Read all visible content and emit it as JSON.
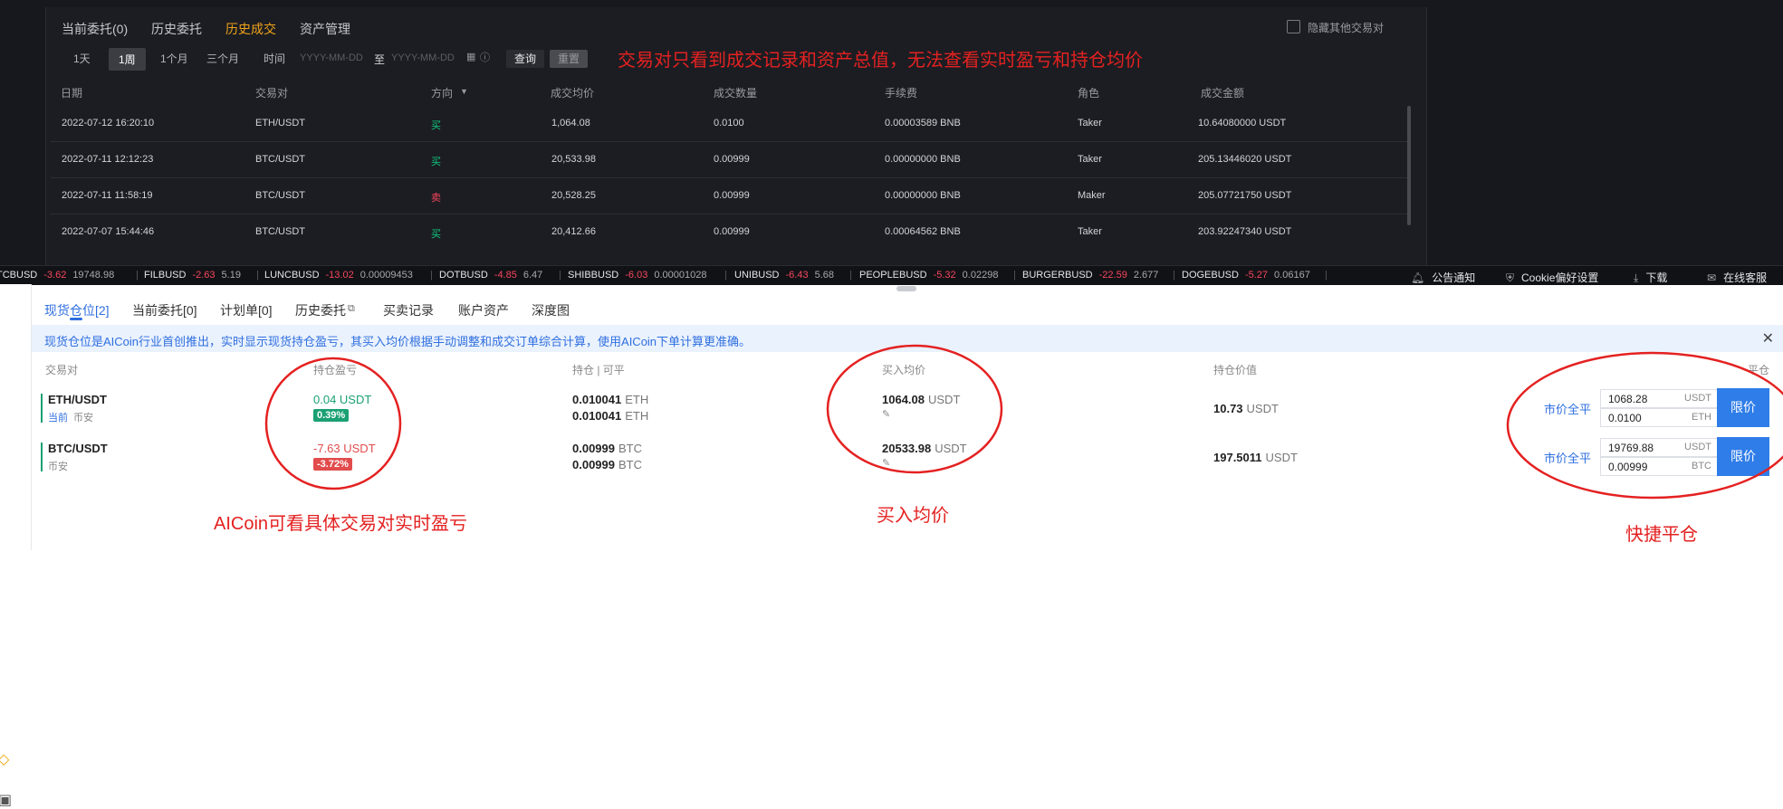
{
  "exchange": {
    "tabs": [
      "当前委托(0)",
      "历史委托",
      "历史成交",
      "资产管理"
    ],
    "active_tab": "历史成交",
    "hide_others_label": "隐藏其他交易对",
    "ranges": [
      "1天",
      "1周",
      "1个月",
      "三个月"
    ],
    "selected_range": "1周",
    "time_label": "时间",
    "date_placeholder": "YYYY-MM-DD",
    "date_sep": "至",
    "query_label": "查询",
    "reset_label": "重置",
    "columns": [
      "日期",
      "交易对",
      "方向",
      "成交均价",
      "成交数量",
      "手续费",
      "角色",
      "成交金额"
    ],
    "rows": [
      {
        "date": "2022-07-12 16:20:10",
        "pair": "ETH/USDT",
        "side": "买",
        "price": "1,064.08",
        "qty": "0.0100",
        "fee": "0.00003589 BNB",
        "role": "Taker",
        "amount": "10.64080000 USDT"
      },
      {
        "date": "2022-07-11 12:12:23",
        "pair": "BTC/USDT",
        "side": "买",
        "price": "20,533.98",
        "qty": "0.00999",
        "fee": "0.00000000 BNB",
        "role": "Taker",
        "amount": "205.13446020 USDT"
      },
      {
        "date": "2022-07-11 11:58:19",
        "pair": "BTC/USDT",
        "side": "卖",
        "price": "20,528.25",
        "qty": "0.00999",
        "fee": "0.00000000 BNB",
        "role": "Maker",
        "amount": "205.07721750 USDT"
      },
      {
        "date": "2022-07-07 15:44:46",
        "pair": "BTC/USDT",
        "side": "买",
        "price": "20,412.66",
        "qty": "0.00999",
        "fee": "0.00064562 BNB",
        "role": "Taker",
        "amount": "203.92247340 USDT"
      }
    ],
    "note": "交易对只看到成交记录和资产总值，无法查看实时盈亏和持仓均价"
  },
  "ticker": {
    "items": [
      {
        "sym": "TCBUSD",
        "chg": "-3.62",
        "price": "19748.98"
      },
      {
        "sym": "FILBUSD",
        "chg": "-2.63",
        "price": "5.19"
      },
      {
        "sym": "LUNCBUSD",
        "chg": "-13.02",
        "price": "0.00009453"
      },
      {
        "sym": "DOTBUSD",
        "chg": "-4.85",
        "price": "6.47"
      },
      {
        "sym": "SHIBBUSD",
        "chg": "-6.03",
        "price": "0.00001028"
      },
      {
        "sym": "UNIBUSD",
        "chg": "-6.43",
        "price": "5.68"
      },
      {
        "sym": "PEOPLEBUSD",
        "chg": "-5.32",
        "price": "0.02298"
      },
      {
        "sym": "BURGERBUSD",
        "chg": "-22.59",
        "price": "2.677"
      },
      {
        "sym": "DOGEBUSD",
        "chg": "-5.27",
        "price": "0.06167"
      }
    ],
    "announce": "公告通知",
    "cookie": "Cookie偏好设置",
    "download": "下载",
    "support": "在线客服"
  },
  "aicoin": {
    "tabs": [
      "现货仓位[2]",
      "当前委托[0]",
      "计划单[0]",
      "历史委托",
      "买卖记录",
      "账户资产",
      "深度图"
    ],
    "active_tab": "现货仓位[2]",
    "banner": "现货仓位是AICoin行业首创推出，实时显示现货持仓盈亏，其买入均价根据手动调整和成交订单综合计算，使用AICoin下单计算更准确。",
    "columns": {
      "pair": "交易对",
      "pnl": "持仓盈亏",
      "hold": "持仓 | 可平",
      "avg": "买入均价",
      "value": "持仓价值",
      "close": "平仓"
    },
    "positions": [
      {
        "pair": "ETH/USDT",
        "current": "当前",
        "exchange": "币安",
        "pnl": "0.04 USDT",
        "pnl_pct": "0.39%",
        "hold": "0.010041",
        "closeable": "0.010041",
        "asset": "ETH",
        "avg": "1064.08",
        "avg_unit": "USDT",
        "value": "10.73",
        "value_unit": "USDT",
        "market_close": "市价全平",
        "price_input": "1068.28",
        "price_unit": "USDT",
        "qty_input": "0.0100",
        "qty_unit": "ETH",
        "limit_label": "限价"
      },
      {
        "pair": "BTC/USDT",
        "current": "",
        "exchange": "币安",
        "pnl": "-7.63 USDT",
        "pnl_pct": "-3.72%",
        "hold": "0.00999",
        "closeable": "0.00999",
        "asset": "BTC",
        "avg": "20533.98",
        "avg_unit": "USDT",
        "value": "197.5011",
        "value_unit": "USDT",
        "market_close": "市价全平",
        "price_input": "19769.88",
        "price_unit": "USDT",
        "qty_input": "0.00999",
        "qty_unit": "BTC",
        "limit_label": "限价"
      }
    ],
    "annotations": {
      "pnl": "AICoin可看具体交易对实时盈亏",
      "avg": "买入均价",
      "close": "快捷平仓"
    }
  },
  "colors": {
    "annotation": "#e42121",
    "buy": "#0ecb81",
    "sell": "#f6465d",
    "accent": "#2f6fe0",
    "active_dark": "#f0a31a"
  }
}
